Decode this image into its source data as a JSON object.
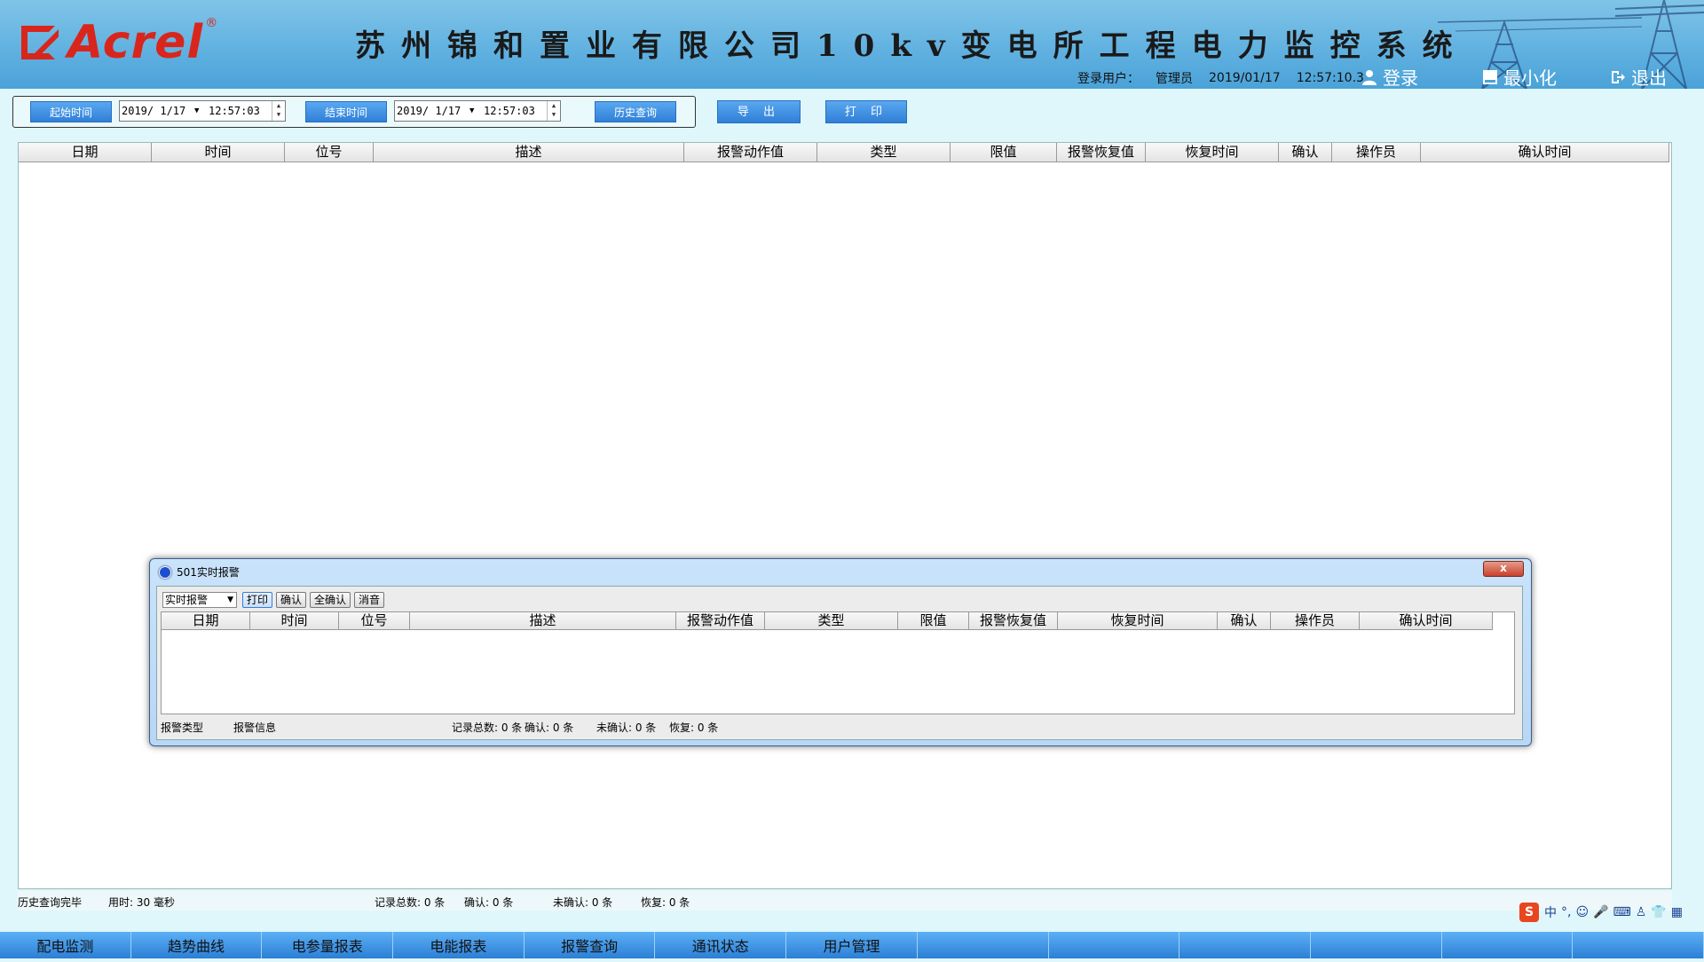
{
  "header": {
    "logo_text": "Acrel",
    "logo_reg": "®",
    "title": "苏州锦和置业有限公司10kv变电所工程电力监控系统",
    "login_label": "登录用户：",
    "user": "管理员",
    "date": "2019/01/17",
    "time": "12:57:10.3",
    "login_btn": "登录",
    "minimize_btn": "最小化",
    "exit_btn": "退出"
  },
  "toolbar": {
    "start_label": "起始时间",
    "start_date": "2019/ 1/17",
    "start_time": "12:57:03",
    "end_label": "结束时间",
    "end_date": "2019/ 1/17",
    "end_time": "12:57:03",
    "query_btn": "历史查询",
    "export_btn": "导 出",
    "print_btn": "打 印"
  },
  "table": {
    "columns": [
      "日期",
      "时间",
      "位号",
      "描述",
      "报警动作值",
      "类型",
      "限值",
      "报警恢复值",
      "恢复时间",
      "确认",
      "操作员",
      "确认时间"
    ]
  },
  "status": {
    "state": "历史查询完毕",
    "elapsed": "用时: 30 毫秒",
    "total": "记录总数: 0 条",
    "confirmed": "确认: 0 条",
    "unconfirmed": "未确认: 0 条",
    "recovered": "恢复: 0 条"
  },
  "popup": {
    "title": "501实时报警",
    "close": "x",
    "select_value": "实时报警",
    "btn_print": "打印",
    "btn_confirm": "确认",
    "btn_confirm_all": "全确认",
    "btn_mute": "消音",
    "columns": [
      "日期",
      "时间",
      "位号",
      "描述",
      "报警动作值",
      "类型",
      "限值",
      "报警恢复值",
      "恢复时间",
      "确认",
      "操作员",
      "确认时间"
    ],
    "status_type": "报警类型",
    "status_info": "报警信息",
    "status_total": "记录总数: 0 条",
    "status_confirmed": "确认: 0 条",
    "status_unconfirmed": "未确认: 0 条",
    "status_recovered": "恢复: 0 条"
  },
  "nav": {
    "tabs": [
      "配电监测",
      "趋势曲线",
      "电参量报表",
      "电能报表",
      "报警查询",
      "通讯状态",
      "用户管理",
      "",
      "",
      "",
      "",
      "",
      ""
    ]
  },
  "ime": {
    "logo": "S",
    "lang": "中",
    "punct": "°,"
  },
  "colors": {
    "header_bg": "#5fb0e0",
    "brand_red": "#d8261c",
    "button_blue": "#2f7fd8",
    "page_bg": "#dff7fb"
  }
}
